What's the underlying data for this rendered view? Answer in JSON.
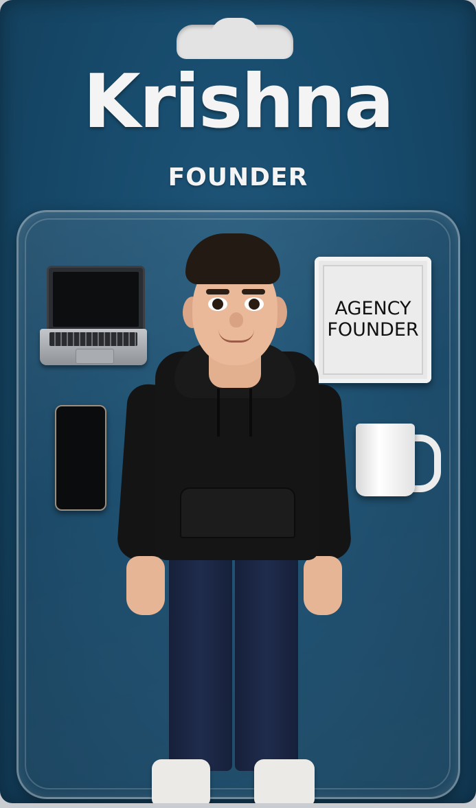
{
  "package": {
    "name": "Krishna",
    "role": "FOUNDER"
  },
  "accessories": {
    "sign_line1": "AGENCY",
    "sign_line2": "FOUNDER"
  },
  "colors": {
    "card_background": "#174a6b",
    "title_text": "#f4f4f4",
    "hoodie": "#151515",
    "jeans": "#1f2c4c"
  }
}
